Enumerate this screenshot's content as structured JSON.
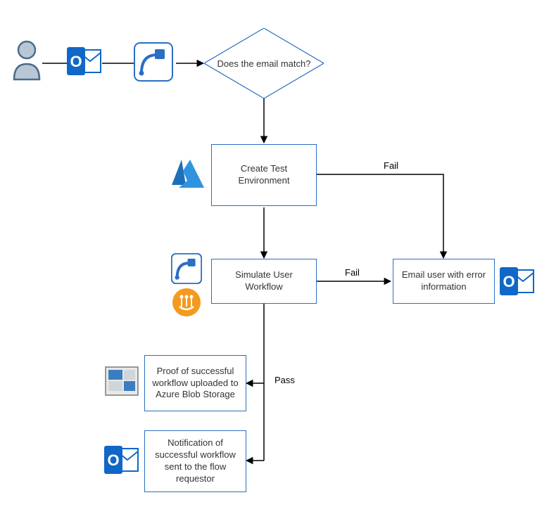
{
  "nodes": {
    "decision": {
      "label": "Does the email match?"
    },
    "create_test_env": {
      "label": "Create Test\nEnvironment"
    },
    "simulate_workflow": {
      "label": "Simulate User Workflow"
    },
    "email_error": {
      "label": "Email user with error\ninformation"
    },
    "proof_blob": {
      "label": "Proof of successful\nworkflow uploaded to\nAzure Blob Storage"
    },
    "notification": {
      "label": "Notification of\nsuccessful workflow\nsent to the flow\nrequestor"
    }
  },
  "edges": {
    "create_to_error": {
      "label": "Fail"
    },
    "simulate_to_error": {
      "label": "Fail"
    },
    "simulate_down": {
      "label": "Pass"
    }
  },
  "icons": {
    "user": "user-icon",
    "outlook_top": "outlook-icon",
    "flow_top": "flow-icon",
    "azure": "azure-icon",
    "flow_side": "flow-icon",
    "leapwork": "leapwork-icon",
    "outlook_right": "outlook-icon",
    "storage": "storage-icon",
    "outlook_bottom": "outlook-icon"
  }
}
